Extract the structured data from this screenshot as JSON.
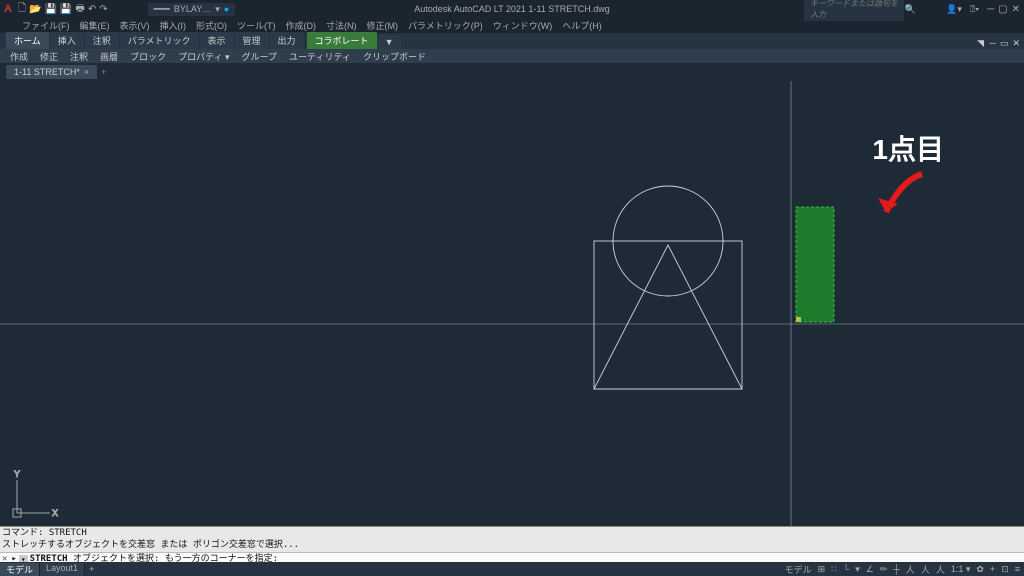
{
  "app": {
    "title_center": "Autodesk AutoCAD LT 2021   1-11 STRETCH.dwg",
    "logo": "A",
    "layer_list": "BYLAY…",
    "search_placeholder": "キーワードまたは語句を入力"
  },
  "menubar": [
    "ファイル(F)",
    "編集(E)",
    "表示(V)",
    "挿入(I)",
    "形式(O)",
    "ツール(T)",
    "作成(D)",
    "寸法(N)",
    "修正(M)",
    "パラメトリック(P)",
    "ウィンドウ(W)",
    "ヘルプ(H)"
  ],
  "ribbon": {
    "tabs": [
      "ホーム",
      "挿入",
      "注釈",
      "パラメトリック",
      "表示",
      "管理",
      "出力"
    ],
    "share": "コラボレート",
    "extra": "▼",
    "panels": [
      "作成",
      "修正",
      "注釈",
      "画層",
      "ブロック",
      "プロパティ ▾",
      "グループ",
      "ユーティリティ",
      "クリップボード"
    ]
  },
  "filetab": {
    "name": "1-11 STRETCH*",
    "close": "×",
    "add": "+"
  },
  "ucs": {
    "y": "Y",
    "x": "X"
  },
  "cmd": {
    "line1": "コマンド: STRETCH",
    "line2": "ストレッチするオブジェクトを交差窓 または ポリゴン交差窓で選択...",
    "input_tag": "▾",
    "input_cmd": "STRETCH",
    "input_prompt": "オブジェクトを選択: もう一方のコーナーを指定:"
  },
  "status": {
    "layouts": [
      "モデル",
      "Layout1"
    ],
    "add": "+",
    "right": [
      "モデル",
      "⊞",
      "∷",
      "└",
      "▾",
      "∠",
      "✏",
      "┼",
      "人",
      "人",
      "人",
      "1:1 ▾",
      "✿",
      "+",
      "⊡",
      "≡"
    ]
  },
  "annotation": {
    "label": "1点目"
  },
  "colors": {
    "selection_green": "#1f8a2a"
  }
}
